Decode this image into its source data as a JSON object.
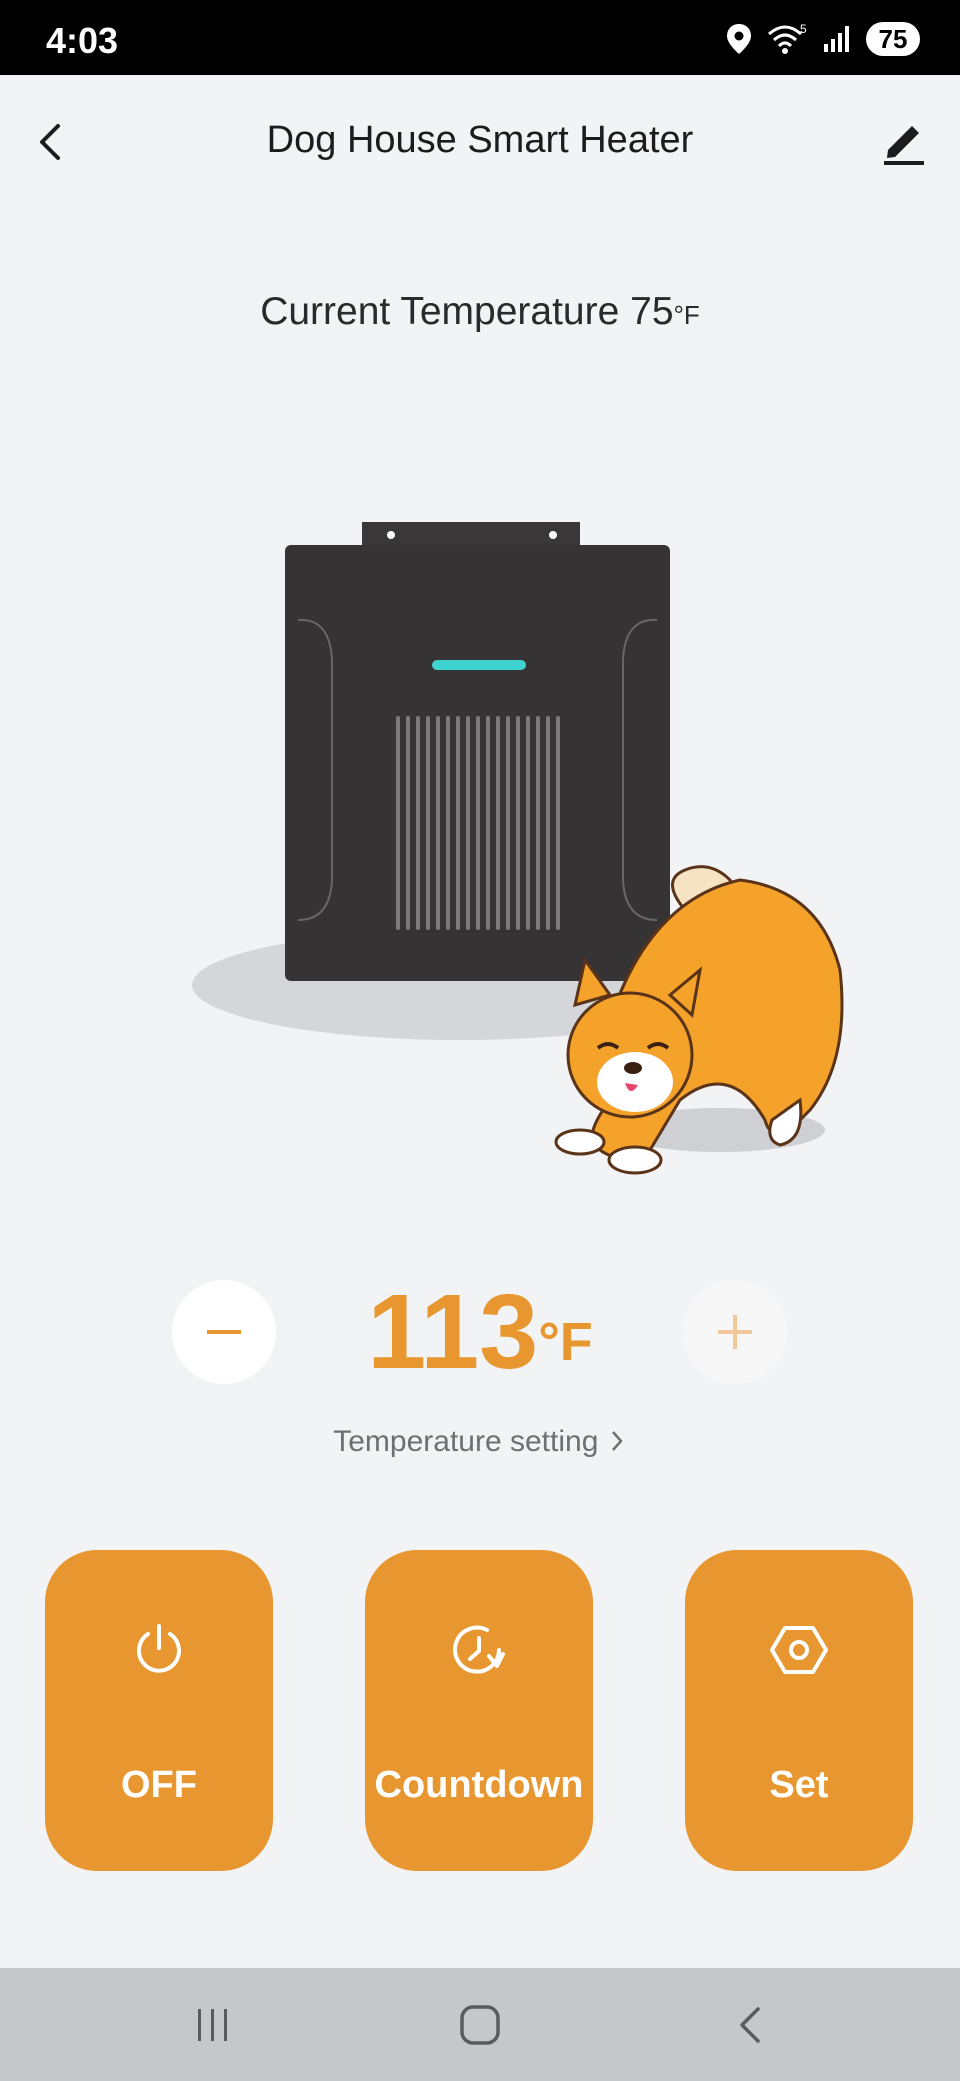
{
  "status_bar": {
    "time": "4:03",
    "battery": "75",
    "icons": [
      "location-icon",
      "wifi-icon",
      "signal-icon",
      "battery-icon"
    ],
    "wifi_label": "5"
  },
  "header": {
    "title": "Dog  House Smart Heater",
    "back_icon": "chevron-left-icon",
    "edit_icon": "pencil-icon"
  },
  "current_temperature": {
    "label": "Current Temperature 75",
    "unit": "°F"
  },
  "target": {
    "value": "113",
    "unit": "°F",
    "decrease_icon": "minus-icon",
    "increase_icon": "plus-icon"
  },
  "temperature_setting_link": "Temperature setting",
  "actions": [
    {
      "label": "OFF",
      "icon": "power-icon"
    },
    {
      "label": "Countdown",
      "icon": "timer-icon"
    },
    {
      "label": "Set",
      "icon": "hexagon-settings-icon"
    }
  ],
  "colors": {
    "accent": "#e8962f",
    "background": "#f2f3f5",
    "navbar": "#c6c7cb",
    "heater_body": "#363334",
    "indicator": "#3fd3cf"
  }
}
